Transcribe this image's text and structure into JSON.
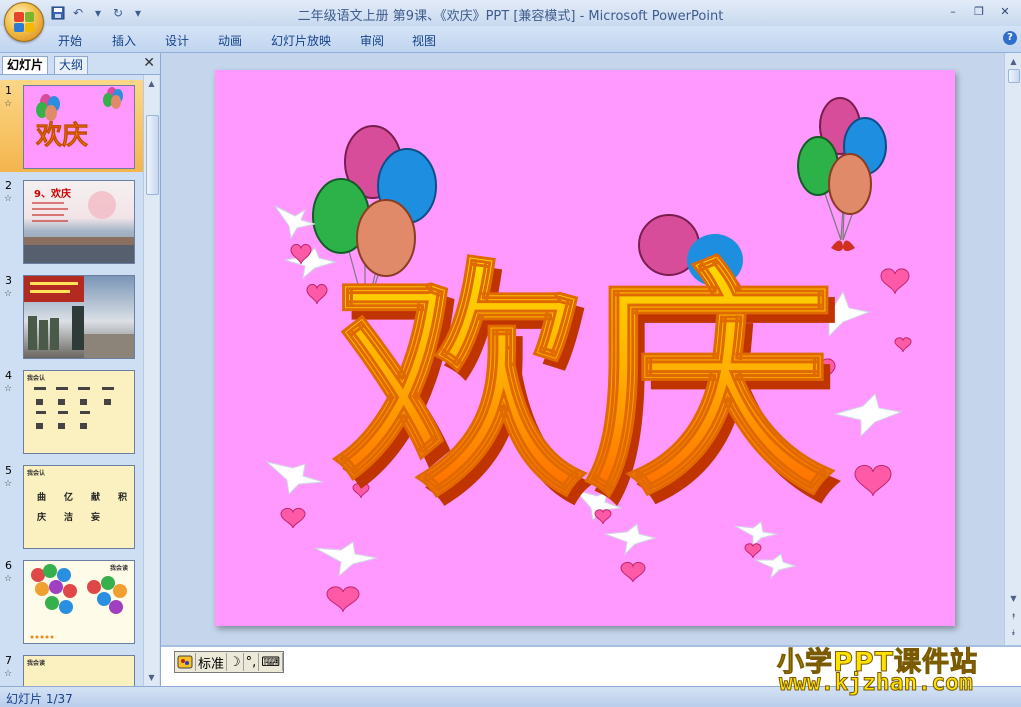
{
  "window": {
    "title": "二年级语文上册  第9课、《欢庆》PPT [兼容模式] - Microsoft PowerPoint",
    "controls": [
      "–",
      "❐",
      "✕"
    ]
  },
  "qat": {
    "save_icon": "floppy-icon",
    "undo_icon": "undo-icon",
    "redo_icon": "redo-icon",
    "customize_icon": "dropdown-icon"
  },
  "ribbon": {
    "tabs": [
      "开始",
      "插入",
      "设计",
      "动画",
      "幻灯片放映",
      "审阅",
      "视图"
    ],
    "help": "?"
  },
  "left_panel": {
    "tabs": [
      "幻灯片",
      "大纲"
    ],
    "close": "✕",
    "slides": [
      {
        "num": "1",
        "anim": "☆",
        "selected": true
      },
      {
        "num": "2",
        "anim": "☆",
        "selected": false,
        "title": "9、欢庆"
      },
      {
        "num": "3",
        "anim": "☆",
        "selected": false
      },
      {
        "num": "4",
        "anim": "☆",
        "selected": false,
        "heading": "我会认"
      },
      {
        "num": "5",
        "anim": "☆",
        "selected": false,
        "heading": "我会认",
        "chars": [
          "曲",
          "亿",
          "献",
          "积",
          "庆",
          "洁",
          "妄"
        ]
      },
      {
        "num": "6",
        "anim": "☆",
        "selected": false,
        "heading": "我会读"
      },
      {
        "num": "7",
        "anim": "☆",
        "selected": false,
        "heading": "我会读"
      }
    ]
  },
  "slide": {
    "title_text": "欢庆",
    "background": "#ff99ff"
  },
  "ime": {
    "mode": "标准",
    "icons": [
      "ime-logo-icon",
      "moon-icon",
      "punctuation-icon",
      "keyboard-icon"
    ]
  },
  "status": {
    "slide_counter": "幻灯片 1/37"
  },
  "watermark": {
    "line1": "小学PPT课件站",
    "line2": "www.kjzhan.com"
  }
}
